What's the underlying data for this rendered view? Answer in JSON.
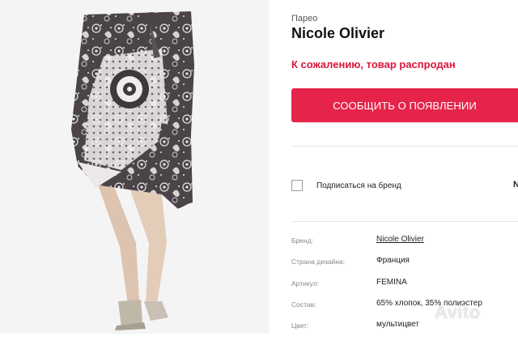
{
  "product": {
    "category": "Парео",
    "brand": "Nicole Olivier",
    "sold_out_text": "К сожалению, товар распродан",
    "notify_button": "СООБЩИТЬ О ПОЯВЛЕНИИ",
    "subscribe_label": "Подписаться на бренд",
    "cut_text": "N"
  },
  "attributes": [
    {
      "label": "Бренд:",
      "value": "Nicole Olivier"
    },
    {
      "label": "Страна дизайна:",
      "value": "Франция"
    },
    {
      "label": "Артикул:",
      "value": "FEMINA"
    },
    {
      "label": "Состав:",
      "value": "65% хлопок, 35% полиэстер"
    },
    {
      "label": "Цвет:",
      "value": "мультицвет"
    }
  ],
  "watermark": "Avito",
  "colors": {
    "accent": "#e6244b",
    "sold_out": "#d9163c"
  }
}
